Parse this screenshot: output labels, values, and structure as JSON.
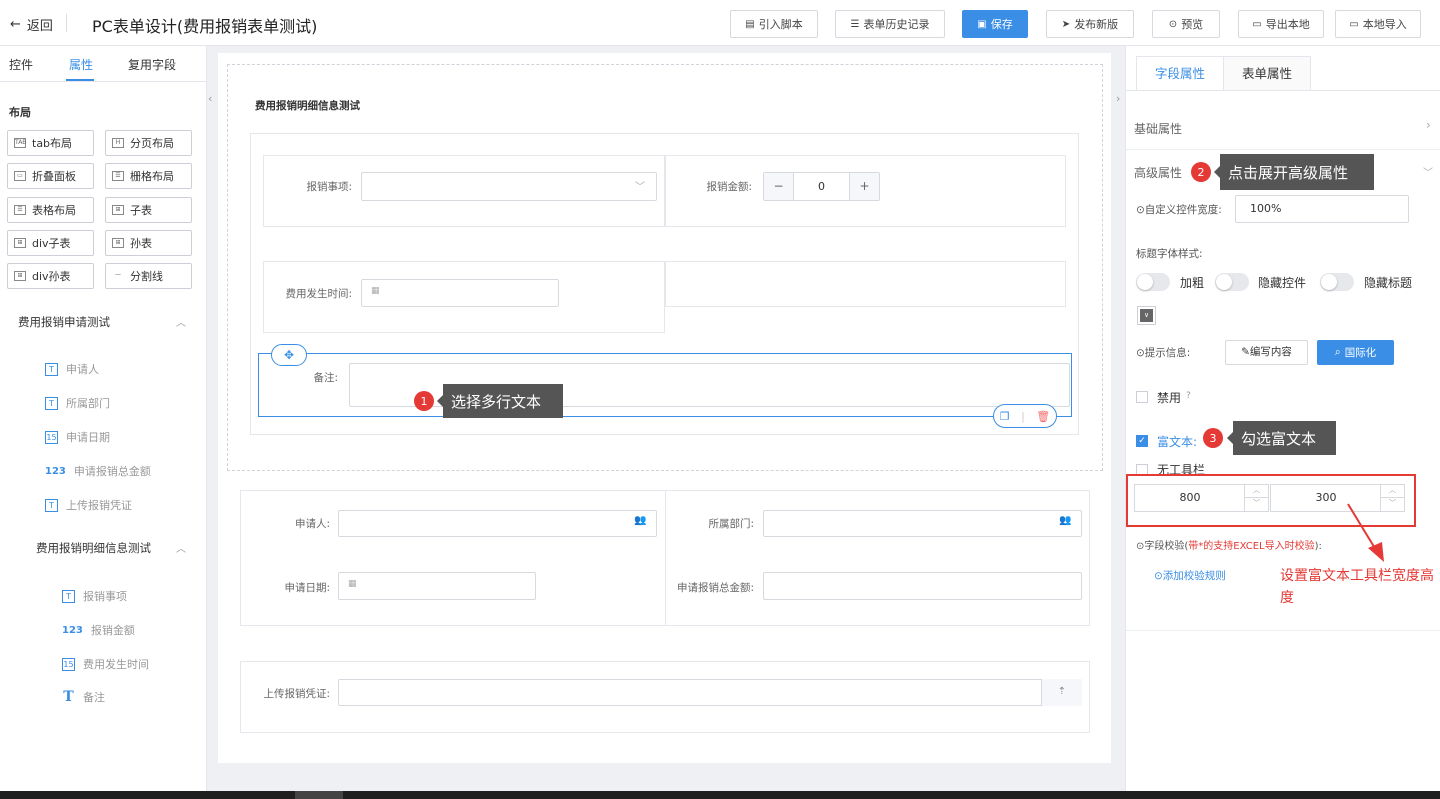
{
  "header": {
    "back_label": "返回",
    "title": "PC表单设计(费用报销表单测试)",
    "buttons": [
      "引入脚本",
      "表单历史记录",
      "保存",
      "发布新版",
      "预览",
      "导出本地",
      "本地导入"
    ],
    "primary_color": "#3a8ee6"
  },
  "left": {
    "tabs": [
      "控件",
      "属性",
      "复用字段"
    ],
    "active_tab": "属性",
    "layout_title": "布局",
    "layout_buttons": [
      {
        "label": "tab布局",
        "icon": "tab-icon"
      },
      {
        "label": "分页布局",
        "icon": "page-icon"
      },
      {
        "label": "折叠面板",
        "icon": "collapse-icon"
      },
      {
        "label": "栅格布局",
        "icon": "grid-icon"
      },
      {
        "label": "表格布局",
        "icon": "table-icon"
      },
      {
        "label": "子表",
        "icon": "table-icon"
      },
      {
        "label": "div子表",
        "icon": "table-icon"
      },
      {
        "label": "孙表",
        "icon": "table-icon"
      },
      {
        "label": "div孙表",
        "icon": "table-icon"
      },
      {
        "label": "分割线",
        "icon": "divider-icon"
      }
    ],
    "group1": {
      "title": "费用报销申请测试",
      "items": [
        {
          "label": "申请人",
          "icon": "T"
        },
        {
          "label": "所属部门",
          "icon": "T"
        },
        {
          "label": "申请日期",
          "icon": "15"
        },
        {
          "label": "申请报销总金额",
          "icon": "123"
        },
        {
          "label": "上传报销凭证",
          "icon": "T"
        }
      ]
    },
    "group2": {
      "title": "费用报销明细信息测试",
      "items": [
        {
          "label": "报销事项",
          "icon": "T"
        },
        {
          "label": "报销金额",
          "icon": "123"
        },
        {
          "label": "费用发生时间",
          "icon": "15"
        },
        {
          "label": "备注",
          "icon": "T"
        }
      ]
    }
  },
  "canvas": {
    "section_title": "费用报销明细信息测试",
    "fields": {
      "item": "报销事项:",
      "amount": "报销金额:",
      "amount_value": "0",
      "time": "费用发生时间:",
      "remark": "备注:",
      "applicant": "申请人:",
      "dept": "所属部门:",
      "apply_date": "申请日期:",
      "total": "申请报销总金额:",
      "upload": "上传报销凭证:"
    }
  },
  "right": {
    "tabs": [
      "字段属性",
      "表单属性"
    ],
    "active_tab": "字段属性",
    "basic": "基础属性",
    "advanced": "高级属性",
    "custom_width_label": "⊙自定义控件宽度:",
    "custom_width_value": "100%",
    "title_font_label": "标题字体样式:",
    "toggles": [
      "加粗",
      "隐藏控件",
      "隐藏标题"
    ],
    "hint_label": "⊙提示信息:",
    "edit_btn": "✎编写内容",
    "intl_btn": "国际化",
    "disabled_label": "禁用",
    "rich_text_label": "富文本:",
    "no_toolbar_label": "无工具栏",
    "width_value": "800",
    "height_value": "300",
    "validate_label": "⊙字段校验(",
    "validate_red": "带*的支持EXCEL导入时校验",
    "validate_end": "):",
    "add_rule": "⊙添加校验规则"
  },
  "annotations": {
    "a1": {
      "num": "1",
      "text": "选择多行文本"
    },
    "a2": {
      "num": "2",
      "text": "点击展开高级属性"
    },
    "a3": {
      "num": "3",
      "text": "勾选富文本"
    },
    "note": "设置富文本工具栏宽度高度",
    "note_color": "#e53935"
  }
}
